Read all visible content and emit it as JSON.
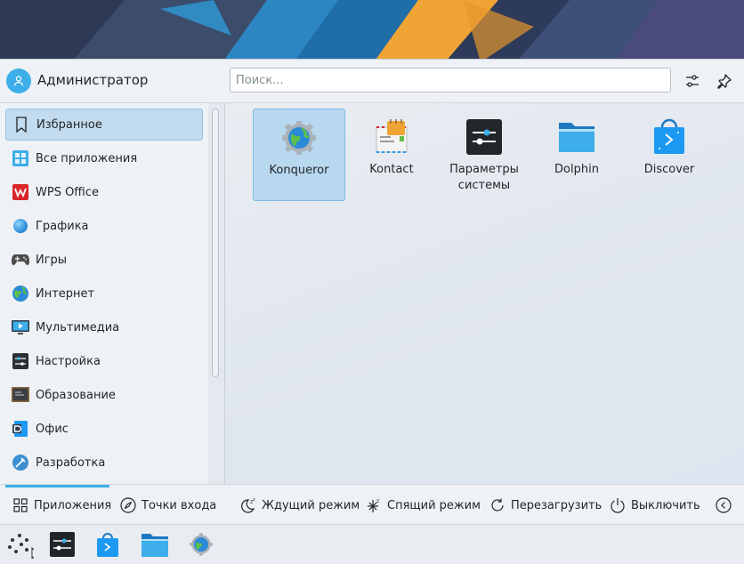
{
  "header": {
    "username": "Администратор",
    "search_placeholder": "Поиск...",
    "configure_icon": "sliders-icon",
    "pin_icon": "pin-icon"
  },
  "sidebar": {
    "items": [
      {
        "label": "Избранное",
        "icon": "bookmark-icon",
        "active": true
      },
      {
        "label": "Все приложения",
        "icon": "grid-apps-icon"
      },
      {
        "label": "WPS Office",
        "icon": "wps-office-icon"
      },
      {
        "label": "Графика",
        "icon": "graphics-icon"
      },
      {
        "label": "Игры",
        "icon": "gamepad-icon"
      },
      {
        "label": "Интернет",
        "icon": "globe-icon"
      },
      {
        "label": "Мультимедиа",
        "icon": "multimedia-icon"
      },
      {
        "label": "Настройка",
        "icon": "settings-icon"
      },
      {
        "label": "Образование",
        "icon": "education-icon"
      },
      {
        "label": "Офис",
        "icon": "office-icon"
      },
      {
        "label": "Разработка",
        "icon": "development-icon"
      }
    ]
  },
  "favorites": [
    {
      "label": "Konqueror",
      "icon": "konqueror-icon",
      "active": true
    },
    {
      "label": "Kontact",
      "icon": "kontact-icon"
    },
    {
      "label": "Параметры системы",
      "icon": "system-settings-icon"
    },
    {
      "label": "Dolphin",
      "icon": "dolphin-icon"
    },
    {
      "label": "Discover",
      "icon": "discover-icon"
    }
  ],
  "footer": {
    "applications": "Приложения",
    "places": "Точки входа",
    "sleep": "Ждущий режим",
    "hibernate": "Спящий режим",
    "restart": "Перезагрузить",
    "shutdown": "Выключить"
  },
  "taskbar": {
    "items": [
      "application-launcher-icon",
      "system-settings-icon",
      "discover-icon",
      "dolphin-icon",
      "konqueror-icon"
    ]
  },
  "colors": {
    "accent": "#3daee9",
    "selection": "#c2dbef"
  }
}
